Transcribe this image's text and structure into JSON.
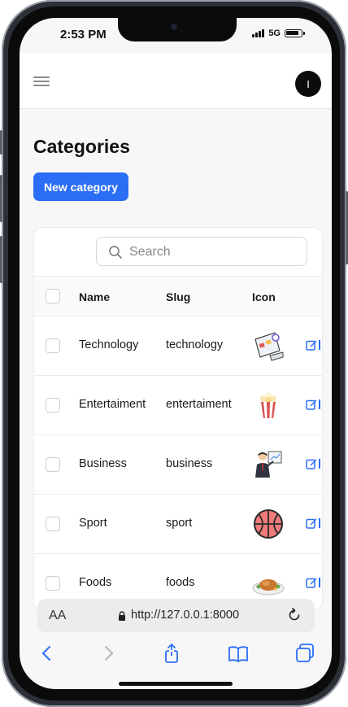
{
  "status": {
    "time": "2:53 PM",
    "network": "5G"
  },
  "header": {
    "avatar_initial": "I"
  },
  "page": {
    "title": "Categories",
    "new_button": "New category"
  },
  "search": {
    "placeholder": "Search"
  },
  "table": {
    "columns": [
      "Name",
      "Slug",
      "Icon"
    ],
    "rows": [
      {
        "name": "Technology",
        "slug": "technology",
        "icon": "tech-dashboard-icon"
      },
      {
        "name": "Entertaiment",
        "slug": "entertaiment",
        "icon": "popcorn-icon"
      },
      {
        "name": "Business",
        "slug": "business",
        "icon": "businessman-presentation-icon"
      },
      {
        "name": "Sport",
        "slug": "sport",
        "icon": "basketball-icon"
      },
      {
        "name": "Foods",
        "slug": "foods",
        "icon": "roast-chicken-icon"
      }
    ]
  },
  "browser": {
    "aa_label": "AA",
    "url": "http://127.0.0.1:8000"
  },
  "colors": {
    "accent": "#2b6ef5",
    "ink": "#111111",
    "background": "#f7f7f7"
  }
}
